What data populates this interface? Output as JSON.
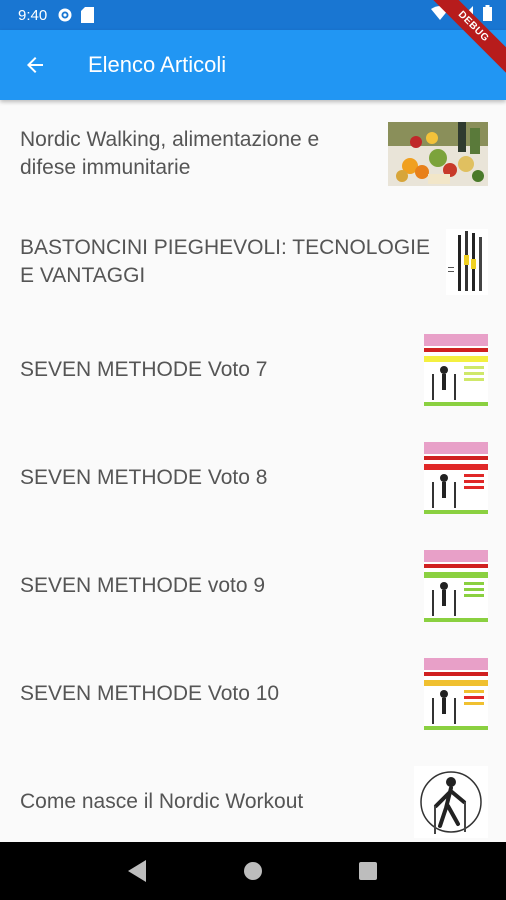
{
  "status_bar": {
    "time": "9:40"
  },
  "debug_banner": "DEBUG",
  "app_bar": {
    "title": "Elenco Articoli"
  },
  "articles": [
    {
      "title": "Nordic Walking, alimentazione e difese immunitarie"
    },
    {
      "title": "BASTONCINI PIEGHEVOLI: TECNOLOGIE E VANTAGGI"
    },
    {
      "title": "SEVEN METHODE Voto 7"
    },
    {
      "title": "SEVEN METHODE Voto 8"
    },
    {
      "title": "SEVEN METHODE voto 9"
    },
    {
      "title": "SEVEN METHODE Voto 10"
    },
    {
      "title": "Come nasce il Nordic Workout"
    }
  ],
  "colors": {
    "app_bar": "#2196f3",
    "status_bar": "#1976d2",
    "text": "#555555"
  }
}
